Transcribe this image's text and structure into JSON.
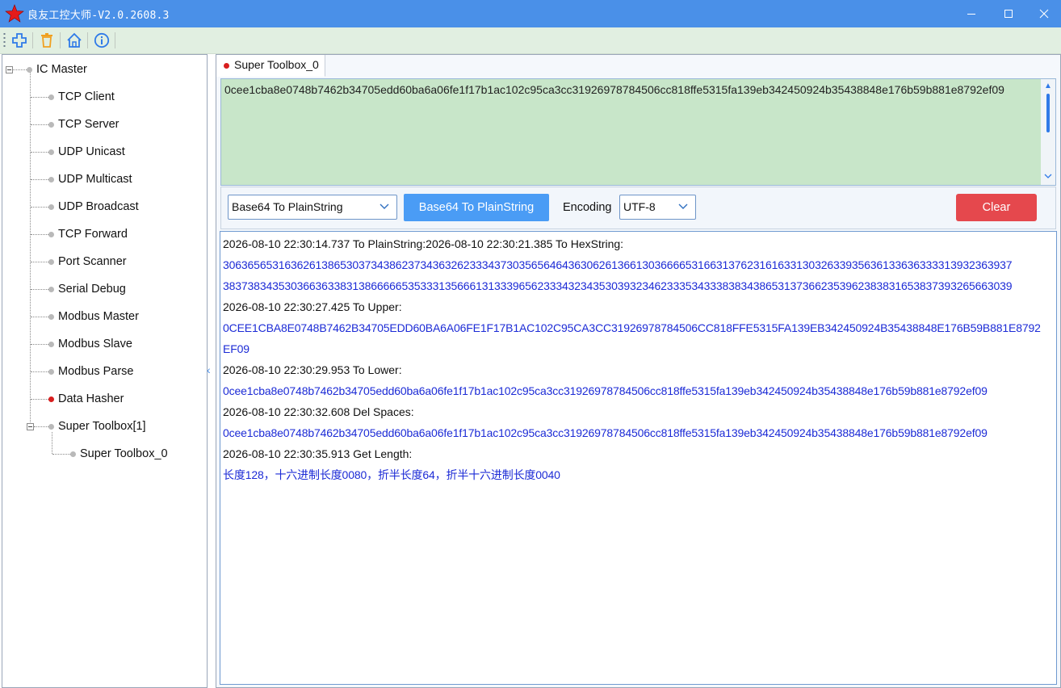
{
  "window": {
    "title": "良友工控大师-V2.0.2608.3",
    "controls": [
      "minimize-icon",
      "maximize-icon",
      "close-icon"
    ]
  },
  "toolbar": {
    "buttons": [
      "add-icon",
      "delete-icon",
      "home-icon",
      "info-icon"
    ]
  },
  "tree": {
    "root": "IC Master",
    "items": [
      {
        "label": "TCP Client"
      },
      {
        "label": "TCP Server"
      },
      {
        "label": "UDP Unicast"
      },
      {
        "label": "UDP Multicast"
      },
      {
        "label": "UDP Broadcast"
      },
      {
        "label": "TCP Forward"
      },
      {
        "label": "Port Scanner"
      },
      {
        "label": "Serial Debug"
      },
      {
        "label": "Modbus Master"
      },
      {
        "label": "Modbus Slave"
      },
      {
        "label": "Modbus Parse"
      },
      {
        "label": "Data Hasher"
      },
      {
        "label": "Super Toolbox[1]"
      }
    ],
    "child": "Super Toolbox_0"
  },
  "tab": {
    "label": "Super Toolbox_0"
  },
  "input": {
    "text": "0cee1cba8e0748b7462b34705edd60ba6a06fe1f17b1ac102c95ca3cc31926978784506cc818ffe5315fa139eb342450924b35438848e176b59b881e8792ef09"
  },
  "controls": {
    "operation_value": "Base64 To PlainString",
    "action_label": "Base64 To PlainString",
    "encoding_label": "Encoding",
    "encoding_value": "UTF-8",
    "clear_label": "Clear"
  },
  "log": [
    {
      "text": "2026-08-10 22:30:14.737 To PlainString:2026-08-10 22:30:21.385 To HexString:",
      "type": "header"
    },
    {
      "text": "30636565316362613865303734386237343632623334373035656464363062613661303666653166313762316163313032633935636133636333313932363937",
      "type": "value"
    },
    {
      "text": "38373834353036636338313866666535333135666131333965623334323435303932346233353433383834386531373662353962383831653837393265663039",
      "type": "value"
    },
    {
      "text": "2026-08-10 22:30:27.425 To Upper:",
      "type": "header"
    },
    {
      "text": "0CEE1CBA8E0748B7462B34705EDD60BA6A06FE1F17B1AC102C95CA3CC31926978784506CC818FFE5315FA139EB342450924B35438848E176B59B881E8792",
      "type": "value"
    },
    {
      "text": "EF09",
      "type": "value"
    },
    {
      "text": "2026-08-10 22:30:29.953 To Lower:",
      "type": "header"
    },
    {
      "text": "0cee1cba8e0748b7462b34705edd60ba6a06fe1f17b1ac102c95ca3cc31926978784506cc818ffe5315fa139eb342450924b35438848e176b59b881e8792ef09",
      "type": "value"
    },
    {
      "text": "2026-08-10 22:30:32.608 Del Spaces:",
      "type": "header"
    },
    {
      "text": "0cee1cba8e0748b7462b34705edd60ba6a06fe1f17b1ac102c95ca3cc31926978784506cc818ffe5315fa139eb342450924b35438848e176b59b881e8792ef09",
      "type": "value"
    },
    {
      "text": "2026-08-10 22:30:35.913 Get Length:",
      "type": "header"
    },
    {
      "text": "长度128，十六进制长度0080，折半长度64，折半十六进制长度0040",
      "type": "value"
    }
  ],
  "colors": {
    "titlebar": "#4a90e8",
    "toolbar": "#e1efe1",
    "input_bg": "#c8e6c9",
    "primary": "#4a9cf5",
    "danger": "#e5484d",
    "log_value": "#1c2bd6",
    "active_dot": "#d81e1e"
  }
}
